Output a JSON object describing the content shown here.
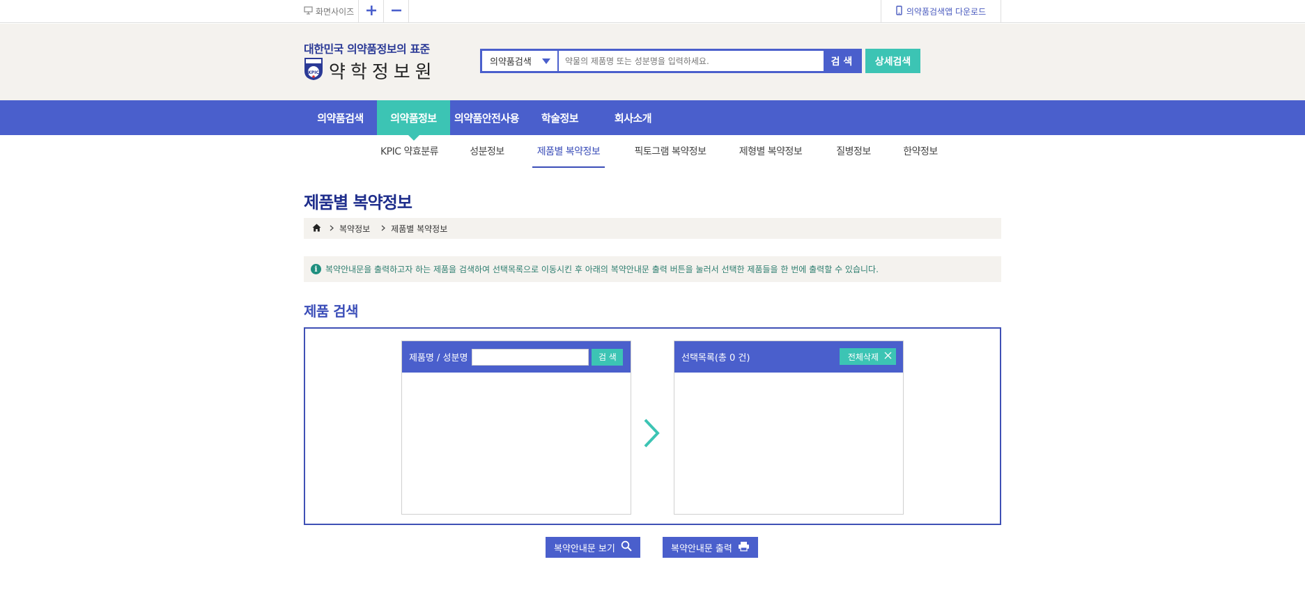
{
  "topbar": {
    "screen_size_label": "화면사이즈",
    "zoom_in": "+",
    "zoom_out": "−",
    "app_download": "의약품검색앱 다운로드"
  },
  "header": {
    "slogan": "대한민국 의약품정보의 표준",
    "logo_name": "약학정보원",
    "logo_badge": "KPIC",
    "search": {
      "select_value": "의약품검색",
      "placeholder": "약물의 제품명 또는 성분명을 입력하세요.",
      "button": "검 색"
    },
    "detail_search": "상세검색"
  },
  "gnb": {
    "items": [
      {
        "label": "의약품검색"
      },
      {
        "label": "의약품정보"
      },
      {
        "label": "의약품안전사용"
      },
      {
        "label": "학술정보"
      },
      {
        "label": "회사소개"
      }
    ]
  },
  "subnav": {
    "items": [
      {
        "label": "KPIC 약효분류"
      },
      {
        "label": "성분정보"
      },
      {
        "label": "제품별 복약정보"
      },
      {
        "label": "픽토그램 복약정보"
      },
      {
        "label": "제형별 복약정보"
      },
      {
        "label": "질병정보"
      },
      {
        "label": "한약정보"
      }
    ]
  },
  "content": {
    "page_title": "제품별 복약정보",
    "breadcrumb": [
      "복약정보",
      "제품별 복약정보"
    ],
    "notice": "복약안내문을 출력하고자 하는 제품을 검색하여 선택목록으로 이동시킨 후 아래의 복약안내문 출력 버튼을 눌러서 선택한 제품들을 한 번에 출력할 수 있습니다.",
    "section_title": "제품 검색",
    "left_panel": {
      "label": "제품명 / 성분명",
      "input_value": "",
      "button": "검 색"
    },
    "right_panel": {
      "label": "선택목록(총 0 건)",
      "delete_all": "전체삭제"
    },
    "actions": {
      "view": "복약안내문 보기",
      "print": "복약안내문 출력"
    }
  },
  "colors": {
    "primary": "#4a5fcc",
    "accent": "#3cc4b4",
    "title": "#1f2e8c",
    "header_bg": "#f4f2ee"
  }
}
